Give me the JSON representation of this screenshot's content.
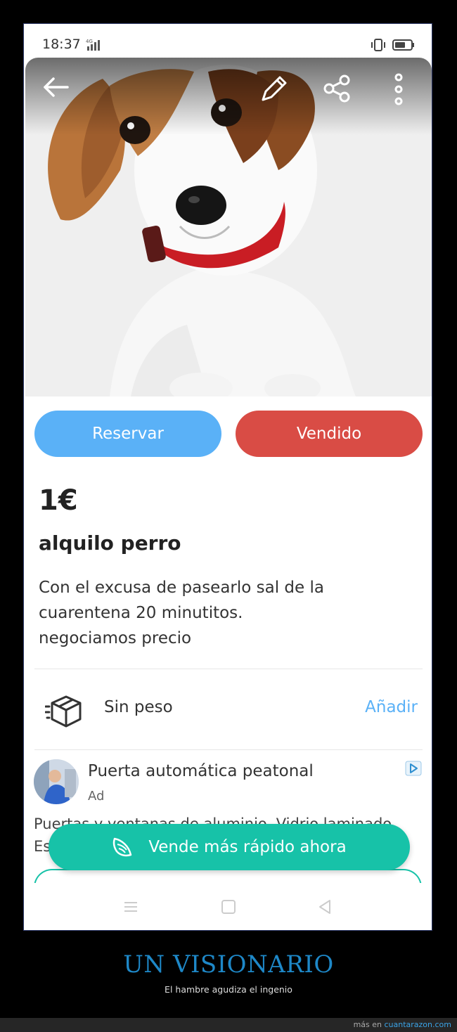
{
  "status_bar": {
    "time": "18:37",
    "network": "4G"
  },
  "listing": {
    "reserve_label": "Reservar",
    "sold_label": "Vendido",
    "price": "1€",
    "title": "alquilo perro",
    "description": [
      "Con el excusa de pasearlo sal de la",
      "cuarentena 20 minutitos.",
      "negociamos precio"
    ],
    "shipping_label": "Sin peso",
    "shipping_action": "Añadir"
  },
  "ad": {
    "title": "Puerta automática peatonal",
    "tag": "Ad",
    "body_line1": "Puertas y ventanas de aluminio. Vidrio laminado.",
    "body_line2": "Es"
  },
  "fab_label": "Vende más rápido ahora",
  "caption": {
    "title": "UN VISIONARIO",
    "subtitle": "El hambre agudiza el ingenio"
  },
  "footer": {
    "prefix": "más en ",
    "site": "cuantarazon.com"
  },
  "colors": {
    "reserve": "#5ab1f7",
    "sold": "#d94c45",
    "accent": "#17c2a8",
    "link": "#5ab1f7"
  }
}
